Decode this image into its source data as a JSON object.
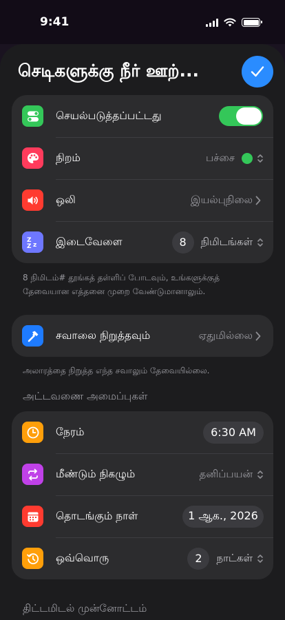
{
  "status": {
    "time": "9:41"
  },
  "header": {
    "title": "செடிகளுக்கு நீர் ஊற்..."
  },
  "alarm_card": {
    "enabled_label": "செயல்படுத்தப்பட்டது",
    "enabled": true,
    "color_label": "நிறம்",
    "color_value": "பச்சை",
    "sound_label": "ஒலி",
    "sound_value": "இயல்புநிலை",
    "snooze_label": "இடைவேளை",
    "snooze_count": "8",
    "snooze_unit": "நிமிடங்கள்"
  },
  "snooze_footnote": "8 நிமிடம்# தூங்கத் தள்ளிப் போடவும், உங்களுக்குத் தேவையான எத்தனை முறை வேண்டுமானாலும்.",
  "challenge_card": {
    "label": "சவாலை நிறுத்தவும்",
    "value": "ஏதுமில்லை"
  },
  "challenge_footnote": "அலாரத்தை நிறுத்த எந்த சவாலும் தேவையில்லை.",
  "schedule_header": "அட்டவணை அமைப்புகள்",
  "schedule_card": {
    "time_label": "நேரம்",
    "time_value": "6:30 AM",
    "repeat_label": "மீண்டும் நிகழும்",
    "repeat_value": "தனிப்பயன்",
    "start_label": "தொடங்கும் நாள்",
    "start_value": "1 ஆக., 2026",
    "every_label": "ஒவ்வொரு",
    "every_count": "2",
    "every_unit": "நாட்கள்"
  },
  "preview_header": "திட்டமிடல் முன்னோட்டம்",
  "colors": {
    "accent": "#2a8cff",
    "toggle_on": "#34c759",
    "color_dot": "#34c759"
  }
}
